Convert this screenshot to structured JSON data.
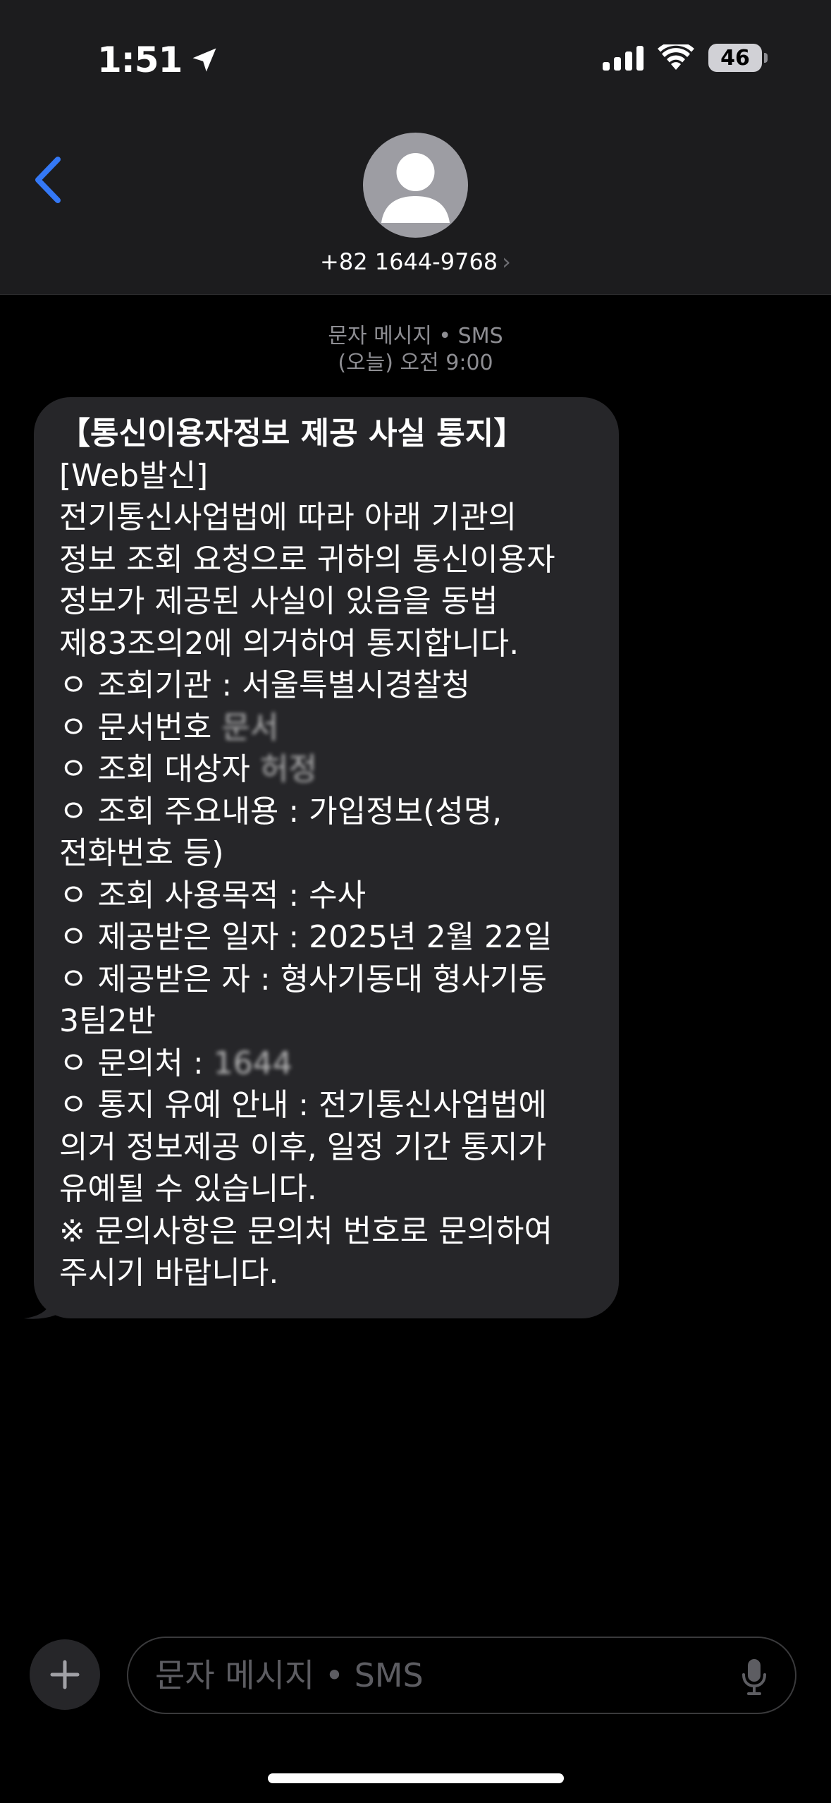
{
  "status_bar": {
    "time": "1:51",
    "battery": "46"
  },
  "header": {
    "contact_number": "+82 1644-9768",
    "chevron": "›"
  },
  "meta": {
    "channel": "문자 메시지 • SMS",
    "timestamp": "(오늘) 오전 9:00"
  },
  "message": {
    "lines": [
      "【통신이용자정보 제공 사실 통지】",
      "[Web발신]",
      "전기통신사업법에 따라 아래 기관의",
      "정보 조회 요청으로 귀하의 통신이용자",
      "정보가 제공된 사실이 있음을 동법",
      "제83조의2에 의거하여 통지합니다.",
      "ㅇ 조회기관 : 서울특별시경찰청",
      "ㅇ 문서번호",
      "ㅇ 조회 대상자",
      "ㅇ 조회 주요내용 : 가입정보(성명,",
      "전화번호 등)",
      "ㅇ 조회 사용목적 : 수사",
      "ㅇ 제공받은 일자 : 2025년 2월 22일",
      "ㅇ 제공받은 자 : 형사기동대 형사기동",
      "3팀2반",
      "ㅇ 문의처 :",
      "ㅇ 통지 유예 안내 : 전기통신사업법에",
      "의거 정보제공 이후, 일정 기간 통지가",
      "유예될 수 있습니다.",
      "※ 문의사항은 문의처 번호로 문의하여",
      "주시기 바랍니다."
    ],
    "redacted_partial": [
      "문서",
      "허정",
      "1644"
    ]
  },
  "input": {
    "placeholder": "문자 메시지 • SMS"
  },
  "colors": {
    "background": "#000000",
    "header_bg": "#1c1c1e",
    "bubble_bg": "#262629",
    "accent": "#3478f6",
    "secondary_text": "#8e8e93"
  },
  "icons": [
    "location-arrow-icon",
    "cellular-signal-icon",
    "wifi-icon",
    "battery-icon",
    "back-chevron-icon",
    "contact-avatar-icon",
    "plus-icon",
    "microphone-icon"
  ]
}
